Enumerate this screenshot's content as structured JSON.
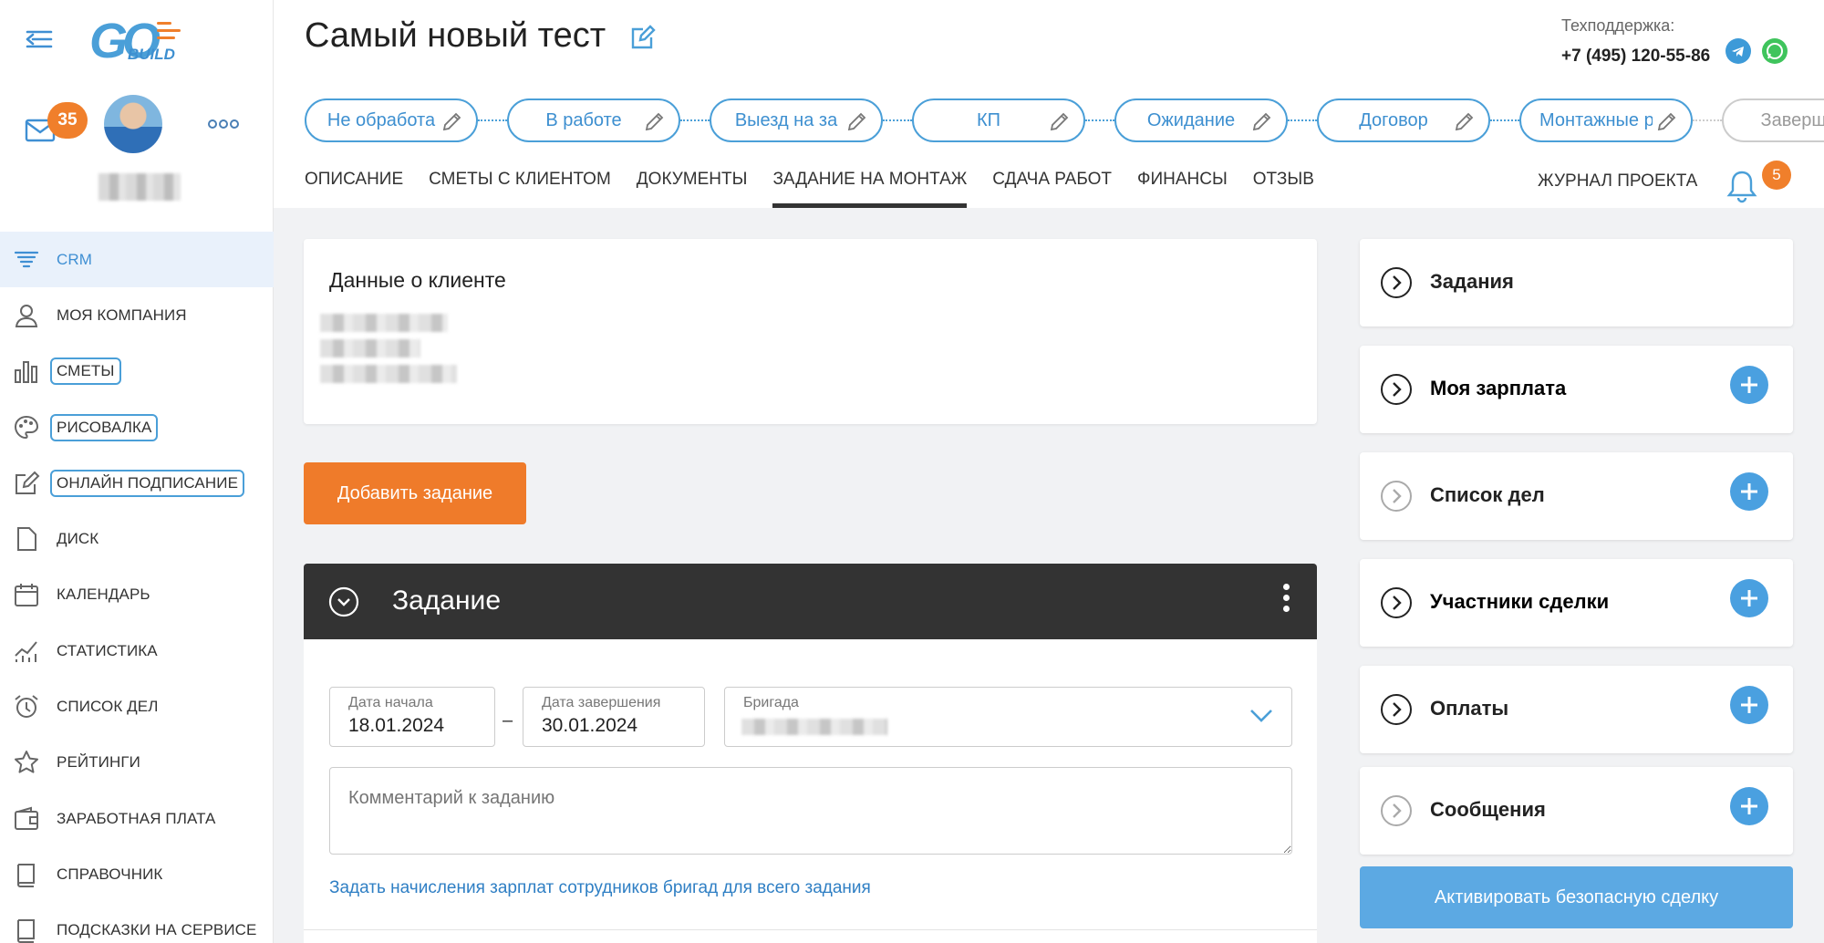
{
  "sidebar": {
    "logo_text": "GO",
    "logo_sub": "BUILD",
    "mail_count": "35",
    "items": [
      {
        "label": "CRM",
        "icon": "funnel-icon"
      },
      {
        "label": "МОЯ КОМПАНИЯ",
        "icon": "user-icon"
      },
      {
        "label": "СМЕТЫ",
        "icon": "bar-chart-icon"
      },
      {
        "label": "РИСОВАЛКА",
        "icon": "palette-icon"
      },
      {
        "label": "ОНЛАЙН ПОДПИСАНИЕ",
        "icon": "edit-icon"
      },
      {
        "label": "ДИСК",
        "icon": "file-icon"
      },
      {
        "label": "КАЛЕНДАРЬ",
        "icon": "calendar-icon"
      },
      {
        "label": "СТАТИСТИКА",
        "icon": "stats-icon"
      },
      {
        "label": "СПИСОК ДЕЛ",
        "icon": "alarm-icon"
      },
      {
        "label": "РЕЙТИНГИ",
        "icon": "star-icon"
      },
      {
        "label": "ЗАРАБОТНАЯ ПЛАТА",
        "icon": "wallet-icon"
      },
      {
        "label": "СПРАВОЧНИК",
        "icon": "book-icon"
      },
      {
        "label": "ПОДСКАЗКИ НА СЕРВИСЕ",
        "icon": "book-icon"
      }
    ]
  },
  "header": {
    "title": "Самый новый тест",
    "support_label": "Техподдержка:",
    "support_phone": "+7 (495) 120-55-86",
    "stages": [
      "Не обработа",
      "В работе",
      "Выезд на за",
      "КП",
      "Ожидание",
      "Договор",
      "Монтажные р",
      "Заверше"
    ],
    "tabs": [
      "ОПИСАНИЕ",
      "СМЕТЫ С КЛИЕНТОМ",
      "ДОКУМЕНТЫ",
      "ЗАДАНИЕ НА МОНТАЖ",
      "СДАЧА РАБОТ",
      "ФИНАНСЫ",
      "ОТЗЫВ"
    ],
    "active_tab": "ЗАДАНИЕ НА МОНТАЖ",
    "journal": "ЖУРНАЛ ПРОЕКТА",
    "notifications": "5"
  },
  "client": {
    "title": "Данные о клиенте"
  },
  "main": {
    "add_task": "Добавить задание",
    "task": {
      "title": "Задание",
      "start_label": "Дата начала",
      "start_value": "18.01.2024",
      "end_label": "Дата завершения",
      "end_value": "30.01.2024",
      "brigade_label": "Бригада",
      "comment_placeholder": "Комментарий к заданию",
      "salary_link": "Задать начисления зарплат сотрудников бригад для всего задания"
    }
  },
  "side": {
    "cards": [
      {
        "label": "Задания",
        "plus": false
      },
      {
        "label": "Моя зарплата",
        "plus": true
      },
      {
        "label": "Список дел",
        "plus": true
      },
      {
        "label": "Участники сделки",
        "plus": true
      },
      {
        "label": "Оплаты",
        "plus": true
      },
      {
        "label": "Сообщения",
        "plus": true
      }
    ],
    "safe_deal": "Активировать безопасную сделку"
  },
  "colors": {
    "accent": "#4a9fd8",
    "orange": "#ef7b2a",
    "dark": "#333333",
    "safe_button": "#5ca9e3"
  }
}
